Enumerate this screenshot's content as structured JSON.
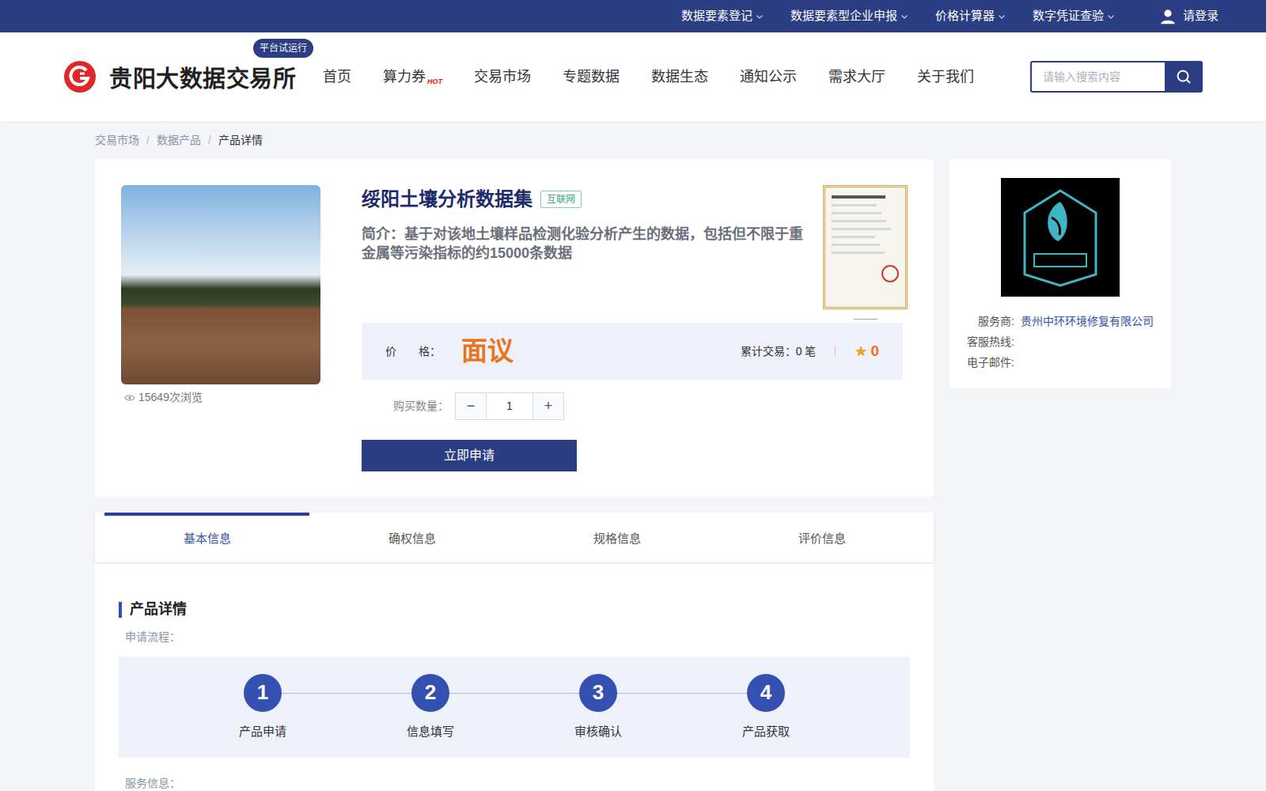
{
  "topbar": {
    "items": [
      {
        "label": "数据要素登记"
      },
      {
        "label": "数据要素型企业申报"
      },
      {
        "label": "价格计算器"
      },
      {
        "label": "数字凭证查验"
      }
    ],
    "login": "请登录"
  },
  "header": {
    "logo": "贵阳大数据交易所",
    "badge": "平台试运行",
    "nav": [
      {
        "label": "首页",
        "hot": false
      },
      {
        "label": "算力券",
        "hot": true
      },
      {
        "label": "交易市场",
        "hot": false
      },
      {
        "label": "专题数据",
        "hot": false
      },
      {
        "label": "数据生态",
        "hot": false
      },
      {
        "label": "通知公示",
        "hot": false
      },
      {
        "label": "需求大厅",
        "hot": false
      },
      {
        "label": "关于我们",
        "hot": false
      }
    ],
    "hot_text": "HOT",
    "search": {
      "placeholder": "请输入搜索内容"
    }
  },
  "breadcrumb": [
    {
      "label": "交易市场",
      "current": false
    },
    {
      "label": "数据产品",
      "current": false
    },
    {
      "label": "产品详情",
      "current": true
    }
  ],
  "product": {
    "views": "15649次浏览",
    "title": "绥阳土壤分析数据集",
    "tag": "互联网",
    "intro": "简介：基于对该地土壤样品检测化验分析产生的数据，包括但不限于重金属等污染指标的约15000条数据",
    "price_label": "价　　格：",
    "price": "面议",
    "trades": "累计交易：0 笔",
    "rating": "0",
    "quantity_label": "购买数量：",
    "minus": "−",
    "quantity": "1",
    "plus": "+",
    "apply": "立即申请"
  },
  "tabs": [
    {
      "label": "基本信息",
      "selected": true
    },
    {
      "label": "确权信息",
      "selected": false
    },
    {
      "label": "规格信息",
      "selected": false
    },
    {
      "label": "评价信息",
      "selected": false
    }
  ],
  "detail": {
    "title": "产品详情",
    "flow_label": "申请流程：",
    "steps": [
      {
        "num": "1",
        "label": "产品申请"
      },
      {
        "num": "2",
        "label": "信息填写"
      },
      {
        "num": "3",
        "label": "审核确认"
      },
      {
        "num": "4",
        "label": "产品获取"
      }
    ],
    "service_label": "服务信息："
  },
  "provider": {
    "label": "服务商:",
    "name": "贵州中环环境修复有限公司",
    "hotline_label": "客服热线:",
    "email_label": "电子邮件:"
  }
}
